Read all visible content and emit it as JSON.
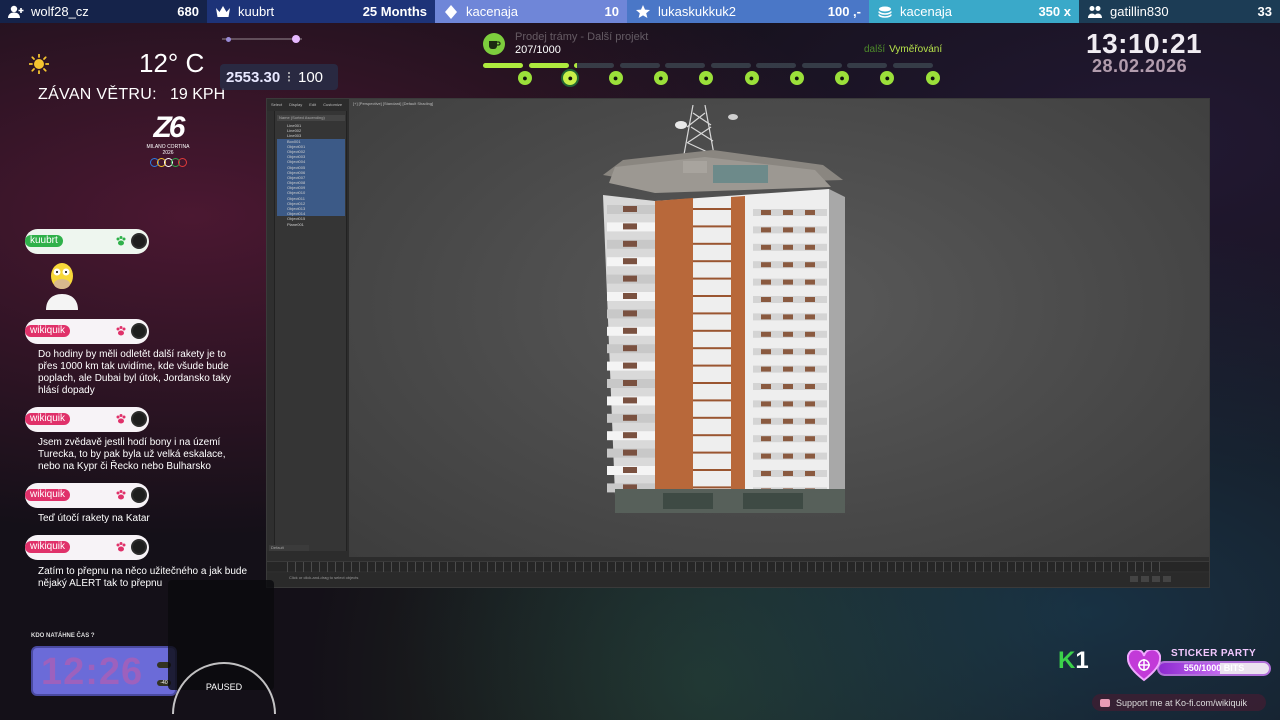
{
  "alerts": [
    {
      "icon": "follower-icon",
      "name": "wolf28_cz",
      "value": "680"
    },
    {
      "icon": "crown-icon",
      "name": "kuubrt",
      "value": "25 Months"
    },
    {
      "icon": "diamond-icon",
      "name": "kacenaja",
      "value": "10"
    },
    {
      "icon": "star-icon",
      "name": "lukaskukkuk2",
      "value": "100 ,-"
    },
    {
      "icon": "coins-icon",
      "name": "kacenaja",
      "value": "350 x"
    },
    {
      "icon": "raid-icon",
      "name": "gatillin830",
      "value": "33"
    }
  ],
  "weather": {
    "icon": "sun-icon",
    "temperature": "12° C",
    "wind_label": "ZÁVAN VĚTRU:",
    "wind_value": "19 KPH"
  },
  "score": {
    "a": "2553.30",
    "separator": "⁝",
    "b": "100"
  },
  "olympics": {
    "mark": "Z6",
    "line1": "MILANO CORTINA",
    "line2": "2026"
  },
  "project": {
    "title": "Prodej trámy - Další projekt",
    "count": "207/1000",
    "next_prefix": "další",
    "next_label": "Vyměřování",
    "progress": 0.207,
    "milestones": [
      "flame-icon",
      "fire-icon",
      "tools-icon",
      "hammer-icon",
      "wrench-icon",
      "bucket-icon",
      "paint-icon",
      "house-icon",
      "key-icon",
      "door-icon"
    ]
  },
  "clock": {
    "time": "13:10:21",
    "date": "28.02.2026"
  },
  "max_window": {
    "menu": [
      "Select",
      "Display",
      "Edit",
      "Customize"
    ],
    "scene_header": "Name (Sorted Ascending)",
    "viewport_label": "[+] [Perspective] [Standard] [Default Shading]",
    "scene_items": [
      "Line001",
      "Line002",
      "Line003",
      "Box001",
      "Object001",
      "Object002",
      "Object003",
      "Object004",
      "Object005",
      "Object006",
      "Object007",
      "Object008",
      "Object009",
      "Object010",
      "Object011",
      "Object012",
      "Object013",
      "Object014",
      "Object015",
      "Plane001"
    ],
    "layer": "Default",
    "status": "Click or click-and-drag to select objects"
  },
  "chat": [
    {
      "user": "kuubrt",
      "color": "#2fb14a",
      "message": ""
    },
    {
      "user": "wikiquik",
      "color": "#e0316a",
      "message": "Do hodiny by měli odletět další rakety je to přes 1000 km tak uvidíme, kde všude bude poplach, ale Dubai byl útok, Jordansko taky hlásí dopady"
    },
    {
      "user": "wikiquik",
      "color": "#e0316a",
      "message": "Jsem zvědavě jestli hodí bony i na území Turecka, to by pak byla už velká eskalace, nebo na Kypr či Řecko nebo Bulharsko"
    },
    {
      "user": "wikiquik",
      "color": "#e0316a",
      "message": "Teď útočí rakety na Katar"
    },
    {
      "user": "wikiquik",
      "color": "#e0316a",
      "message": "Zatím to přepnu na něco užitečného a jak bude nějaký ALERT tak to přepnu"
    }
  ],
  "timer": {
    "label": "KDO NATÁHNE ČAS ?",
    "value": "12:26",
    "chip_a": "",
    "chip_b": "-40"
  },
  "cam": {
    "status": "PAUSED"
  },
  "k1": {
    "k": "K",
    "n": "1"
  },
  "sticker": {
    "title": "STICKER PARTY",
    "text": "550/1000 BITS",
    "progress": 0.55
  },
  "kofi": {
    "text": "Support me at Ko-fi.com/wikiquik"
  }
}
